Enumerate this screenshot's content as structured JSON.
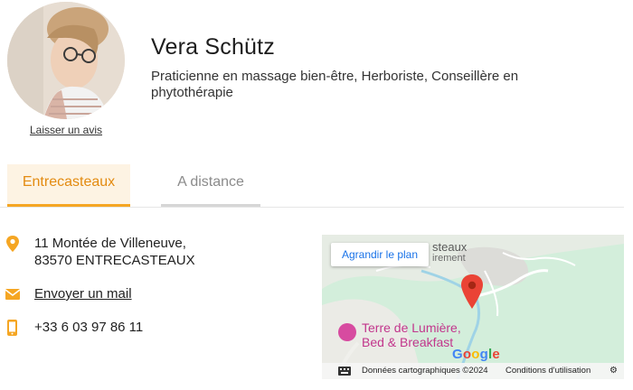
{
  "profile": {
    "name": "Vera Schütz",
    "subtitle": "Praticienne en massage bien-être, Herboriste, Conseillère en phytothérapie",
    "review_link": "Laisser un avis"
  },
  "tabs": [
    {
      "label": "Entrecasteaux",
      "active": true
    },
    {
      "label": "A distance",
      "active": false
    }
  ],
  "contact": {
    "address_line1": "11 Montée de Villeneuve,",
    "address_line2": "83570 ENTRECASTEAUX",
    "email_label": "Envoyer un mail",
    "phone": "+33 6 03 97 86 11",
    "icon_color": "#f5a623"
  },
  "map": {
    "button_label": "Agrandir le plan",
    "top_label": "steaux",
    "top_label_2": "irement",
    "poi_line1": "Terre de Lumière,",
    "poi_line2": "Bed & Breakfast",
    "attribution": "Données cartographiques ©2024",
    "terms": "Conditions d'utilisation",
    "logo": "Google"
  },
  "colors": {
    "accent": "#f5a623",
    "active_tab_bg": "#fdf3e3",
    "active_tab_text": "#e38b11",
    "map_link": "#1a73e8",
    "marker": "#ea4335",
    "poi": "#d74ba0"
  }
}
